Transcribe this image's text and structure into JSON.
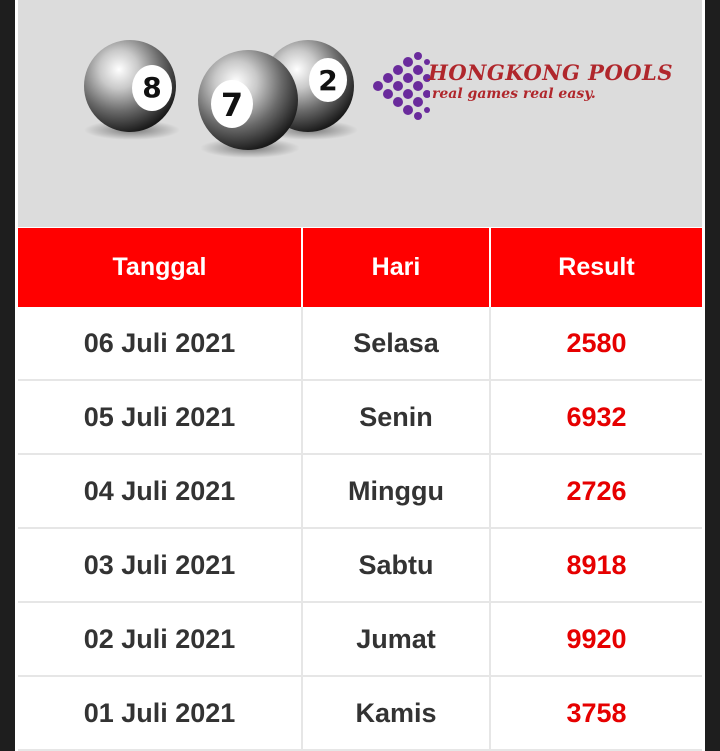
{
  "banner": {
    "balls": [
      "8",
      "7",
      "2"
    ],
    "logo": {
      "brand": "HONGKONG POOLS",
      "tagline": "real games real easy."
    }
  },
  "table": {
    "headers": [
      "Tanggal",
      "Hari",
      "Result"
    ],
    "rows": [
      {
        "tanggal": "06 Juli 2021",
        "hari": "Selasa",
        "result": "2580"
      },
      {
        "tanggal": "05 Juli 2021",
        "hari": "Senin",
        "result": "6932"
      },
      {
        "tanggal": "04 Juli 2021",
        "hari": "Minggu",
        "result": "2726"
      },
      {
        "tanggal": "03 Juli 2021",
        "hari": "Sabtu",
        "result": "8918"
      },
      {
        "tanggal": "02 Juli 2021",
        "hari": "Jumat",
        "result": "9920"
      },
      {
        "tanggal": "01 Juli 2021",
        "hari": "Kamis",
        "result": "3758"
      }
    ]
  },
  "colors": {
    "header_bg": "#ff0000",
    "result_text": "#e60000",
    "banner_bg": "#dcdcdc"
  }
}
